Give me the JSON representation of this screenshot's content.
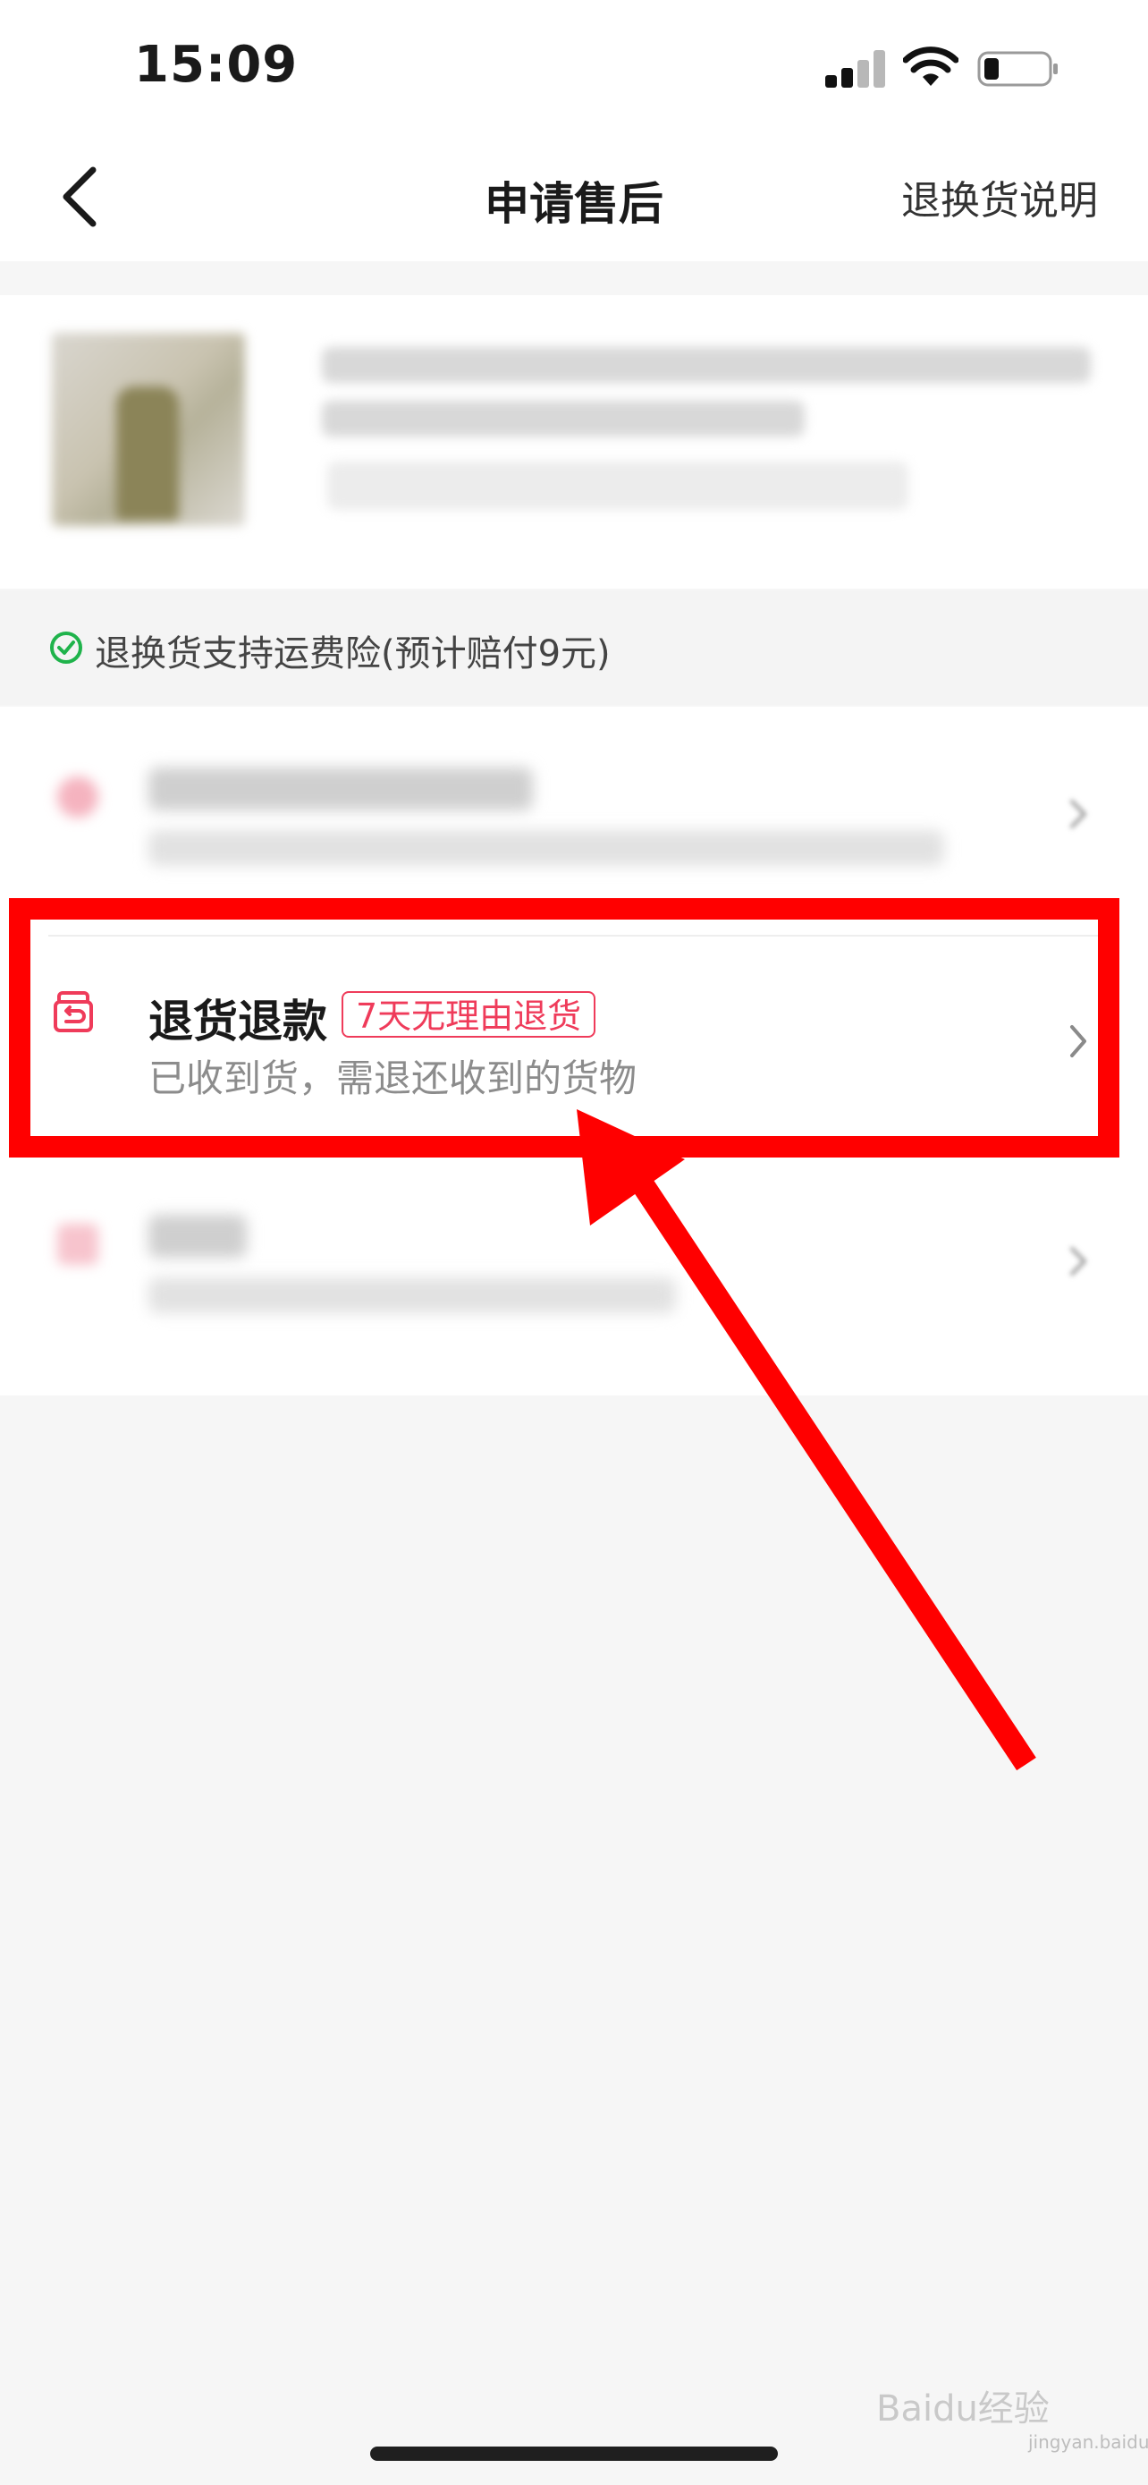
{
  "status_bar": {
    "time": "15:09"
  },
  "nav": {
    "title": "申请售后",
    "right_action": "退换货说明",
    "back_icon": "chevron-left-icon"
  },
  "insurance": {
    "text": "退换货支持运费险(预计赔付9元)",
    "icon": "check-circle-icon",
    "color": "#1fb34b"
  },
  "options": {
    "return_refund": {
      "title": "退货退款",
      "tag": "7天无理由退货",
      "subtitle": "已收到货，需退还收到的货物",
      "icon": "return-box-icon"
    }
  },
  "watermark": {
    "brand": "Baidu经验",
    "url": "jingyan.baidu.com"
  },
  "colors": {
    "accent": "#ef3b5a",
    "annotation": "#ff0000",
    "page_bg": "#f6f6f6"
  }
}
